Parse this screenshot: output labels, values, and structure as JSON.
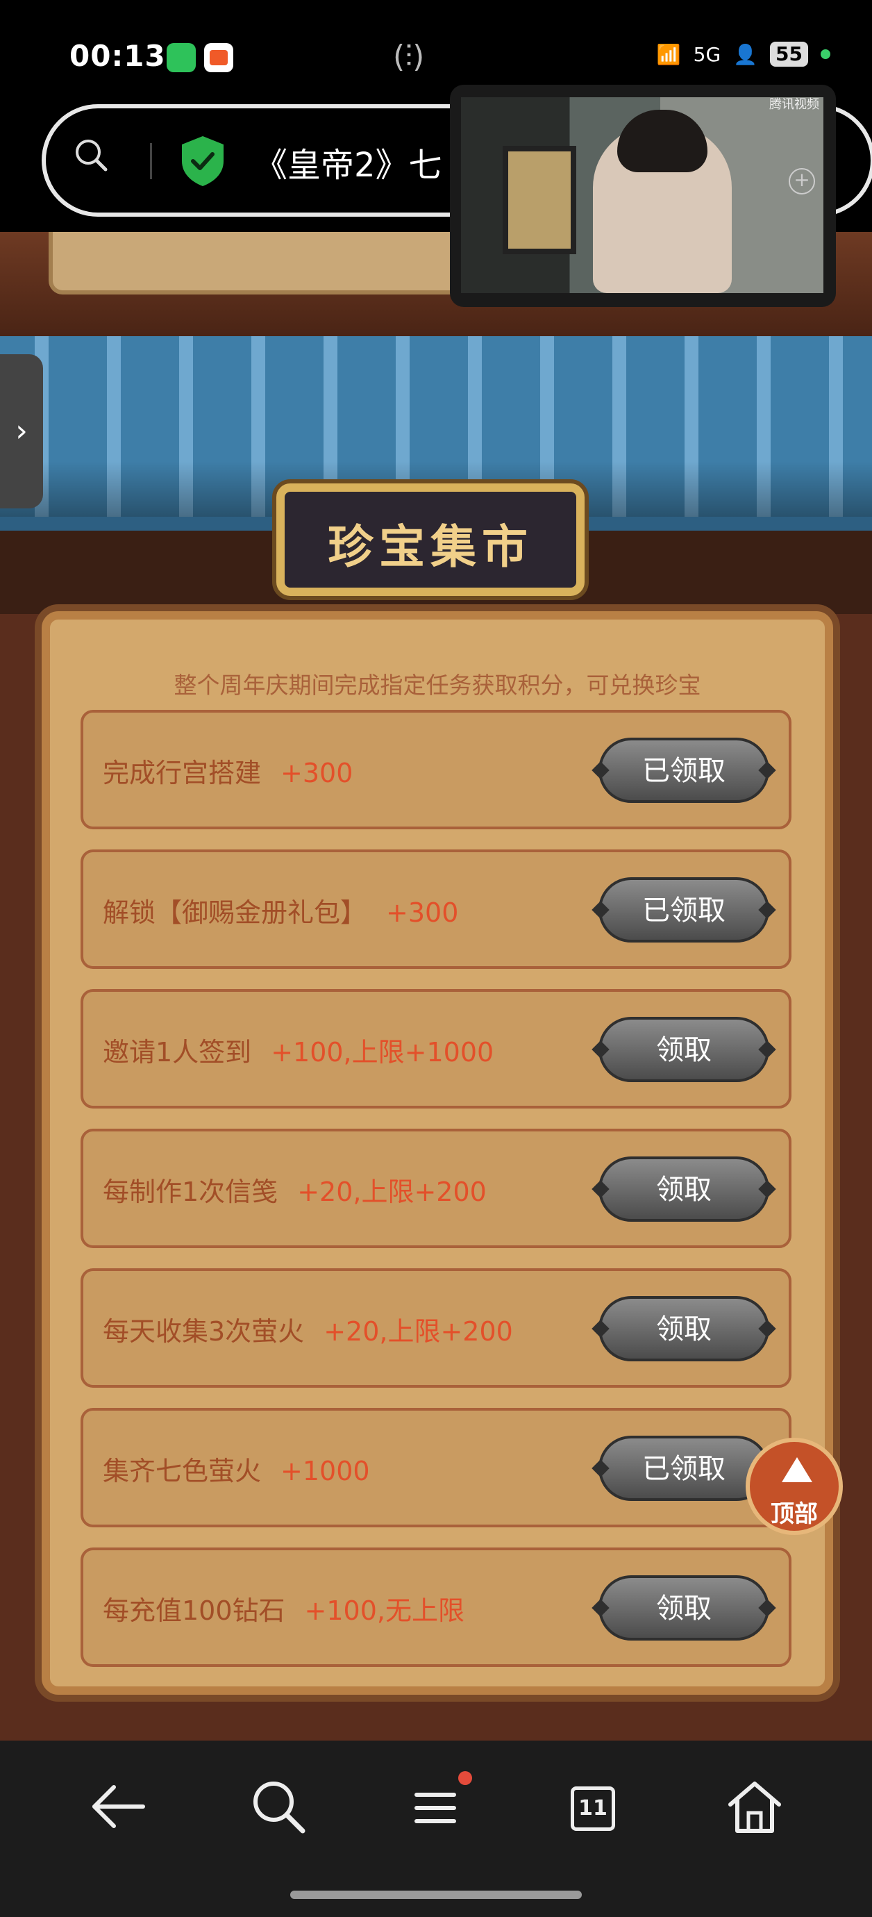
{
  "status_bar": {
    "time": "00:13",
    "network": "5G",
    "battery": "55"
  },
  "browser": {
    "address_text": "《皇帝2》七"
  },
  "pip": {
    "brand": "腾讯视频"
  },
  "sign": {
    "title": "珍宝集市"
  },
  "panel": {
    "subtitle": "整个周年庆期间完成指定任务获取积分，可兑换珍宝",
    "tasks": [
      {
        "name": "完成行宫搭建",
        "points": "+300",
        "button": "已领取"
      },
      {
        "name": "解锁【御赐金册礼包】",
        "points": "+300",
        "button": "已领取"
      },
      {
        "name": "邀请1人签到",
        "points": "+100,上限+1000",
        "button": "领取"
      },
      {
        "name": "每制作1次信笺",
        "points": "+20,上限+200",
        "button": "领取"
      },
      {
        "name": "每天收集3次萤火",
        "points": "+20,上限+200",
        "button": "领取"
      },
      {
        "name": "集齐七色萤火",
        "points": "+1000",
        "button": "已领取"
      },
      {
        "name": "每充值100钻石",
        "points": "+100,无上限",
        "button": "领取"
      }
    ]
  },
  "back_to_top": {
    "label": "顶部"
  },
  "navbar": {
    "tab_count": "11"
  }
}
